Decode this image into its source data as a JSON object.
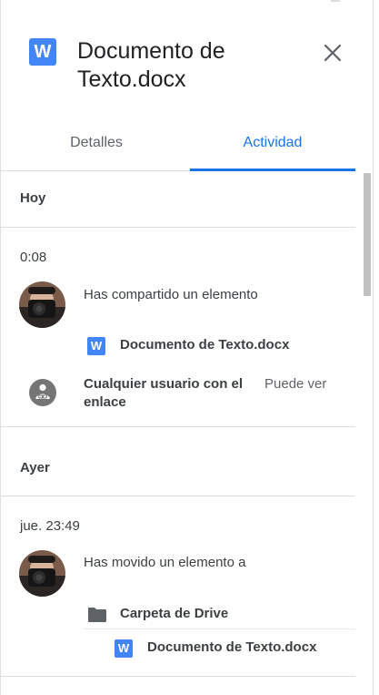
{
  "header": {
    "app_icon_letter": "W",
    "title": "Documento de Texto.docx"
  },
  "tabs": [
    {
      "label": "Detalles",
      "selected": false
    },
    {
      "label": "Actividad",
      "selected": true
    }
  ],
  "colors": {
    "accent": "#1a73e8",
    "word_blue": "#4285f4",
    "divider": "#dadce0"
  },
  "activity": [
    {
      "day": "Hoy",
      "time": "0:08",
      "action": "Has compartido un elemento",
      "file": {
        "icon": "word-icon",
        "icon_letter": "W",
        "name": "Documento de Texto.docx"
      },
      "permission": {
        "icon": "link-icon",
        "user": "Cualquier usuario con el enlace",
        "level": "Puede ver"
      }
    },
    {
      "day": "Ayer",
      "time": "jue. 23:49",
      "action": "Has movido un elemento a",
      "folder": {
        "icon": "folder-icon",
        "name": "Carpeta de Drive"
      },
      "file": {
        "icon": "word-icon",
        "icon_letter": "W",
        "name": "Documento de Texto.docx"
      }
    }
  ]
}
